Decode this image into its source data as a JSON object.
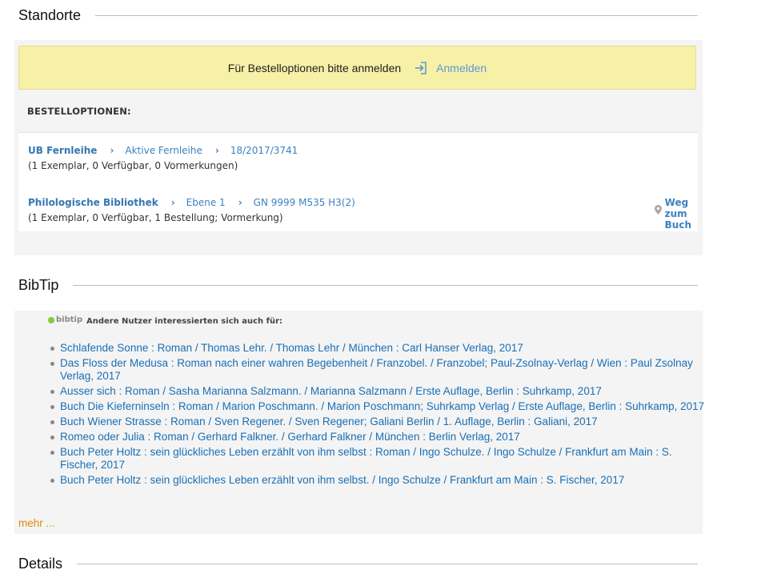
{
  "standorte": {
    "title": "Standorte",
    "login_prompt": "Für Bestelloptionen bitte anmelden",
    "login_label": "Anmelden",
    "bestelloptionen_header": "BESTELLOPTIONEN:",
    "options": [
      {
        "library": "UB Fernleihe",
        "location": "Aktive Fernleihe",
        "signature": "18/2017/3741",
        "info": "(1 Exemplar, 0 Verfügbar, 0 Vormerkungen)"
      },
      {
        "library": "Philologische Bibliothek",
        "location": "Ebene 1",
        "signature": "GN 9999 M535 H3(2)",
        "info": "(1 Exemplar, 0 Verfügbar, 1 Bestellung; Vormerkung)",
        "route_label_1": "Weg",
        "route_label_2": "zum",
        "route_label_3": "Buch"
      }
    ]
  },
  "bibtip": {
    "title": "BibTip",
    "logo_text": "bibtip",
    "intro": "Andere Nutzer interessierten sich auch für:",
    "items": [
      "Schlafende Sonne : Roman / Thomas Lehr. / Thomas Lehr / München : Carl Hanser Verlag, 2017",
      "Das Floss der Medusa : Roman nach einer wahren Begebenheit / Franzobel. / Franzobel; Paul-Zsolnay-Verlag / Wien : Paul Zsolnay Verlag, 2017",
      "Ausser sich : Roman / Sasha Marianna Salzmann. / Marianna Salzmann / Erste Auflage, Berlin : Suhrkamp, 2017",
      "Buch Die Kieferninseln : Roman / Marion Poschmann. / Marion Poschmann; Suhrkamp Verlag / Erste Auflage, Berlin : Suhrkamp, 2017",
      "Buch Wiener Strasse : Roman / Sven Regener. / Sven Regener; Galiani Berlin / 1. Auflage, Berlin : Galiani, 2017",
      "Romeo oder Julia : Roman / Gerhard Falkner. / Gerhard Falkner / München : Berlin Verlag, 2017",
      "Buch Peter Holtz : sein glückliches Leben erzählt von ihm selbst : Roman / Ingo Schulze. / Ingo Schulze / Frankfurt am Main : S. Fischer, 2017",
      "Buch Peter Holtz : sein glückliches Leben erzählt von ihm selbst. / Ingo Schulze / Frankfurt am Main : S. Fischer, 2017"
    ],
    "more_label": "mehr ..."
  },
  "details": {
    "title": "Details"
  },
  "colors": {
    "link": "#1a6fb5",
    "login_bg": "#f7f0a7",
    "more": "#e08a00",
    "bibtip_green": "#8dc63f"
  }
}
